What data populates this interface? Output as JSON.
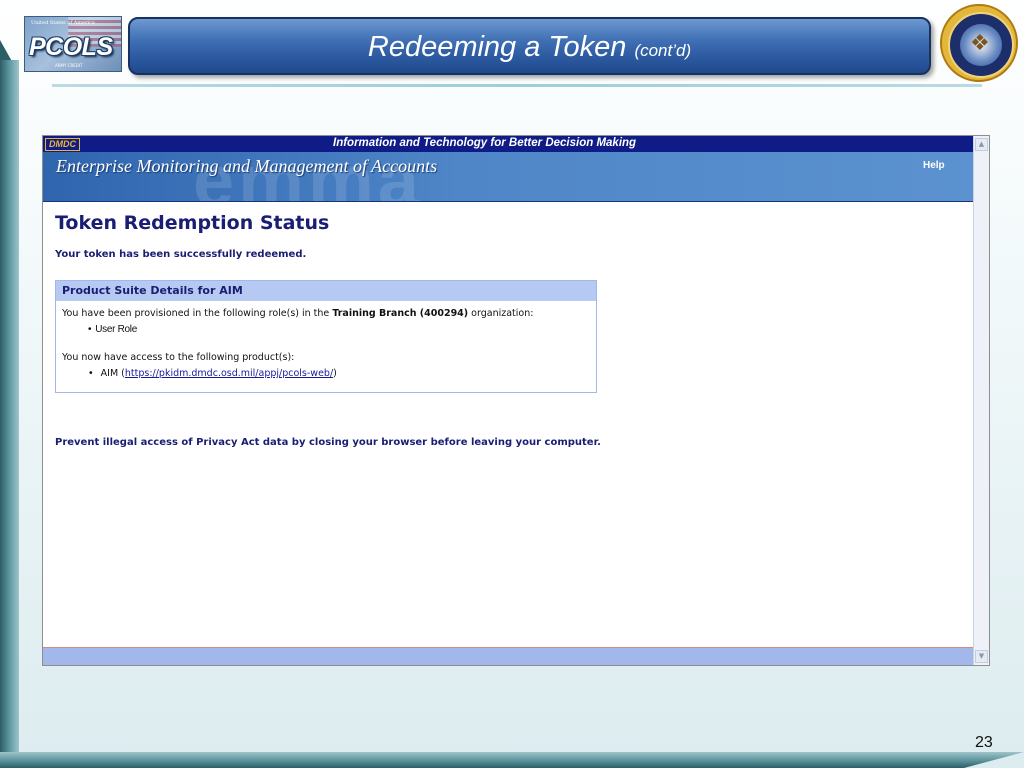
{
  "slide": {
    "title": "Redeeming a Token",
    "title_suffix": "(cont’d)",
    "number": "23",
    "logo": {
      "word": "PCOLS",
      "seal_text": "United States of America",
      "sub_text": "ARMY CREDIT"
    },
    "seal_name": "dod-seal"
  },
  "app": {
    "dmdc_badge": "DMDC",
    "tagline": "Information and Technology for Better Decision Making",
    "banner_title": "Enterprise Monitoring and Management of Accounts",
    "banner_watermark": "emma",
    "help_label": "Help",
    "scroll_up": "▲",
    "scroll_down": "▼"
  },
  "content": {
    "heading": "Token Redemption Status",
    "success_message": "Your token has been successfully redeemed.",
    "panel": {
      "header": "Product Suite Details for AIM",
      "provision_prefix": "You have been provisioned in the following role(s) in the",
      "organization": "Training Branch (400294)",
      "provision_suffix": "organization:",
      "roles": [
        "User Role"
      ],
      "access_intro": "You now have access to the following product(s):",
      "product_name": "AIM",
      "product_url": "https://pkidm.dmdc.osd.mil/appj/pcols-web/"
    },
    "privacy_message": "Prevent illegal access of Privacy Act data by closing your browser before leaving your computer."
  },
  "colors": {
    "banner_blue": "#2d5aa0",
    "dmdc_navy": "#0f1c87",
    "heading_navy": "#1a1e73",
    "panel_header": "#b6c9f2",
    "badge_gold": "#e8b631"
  }
}
